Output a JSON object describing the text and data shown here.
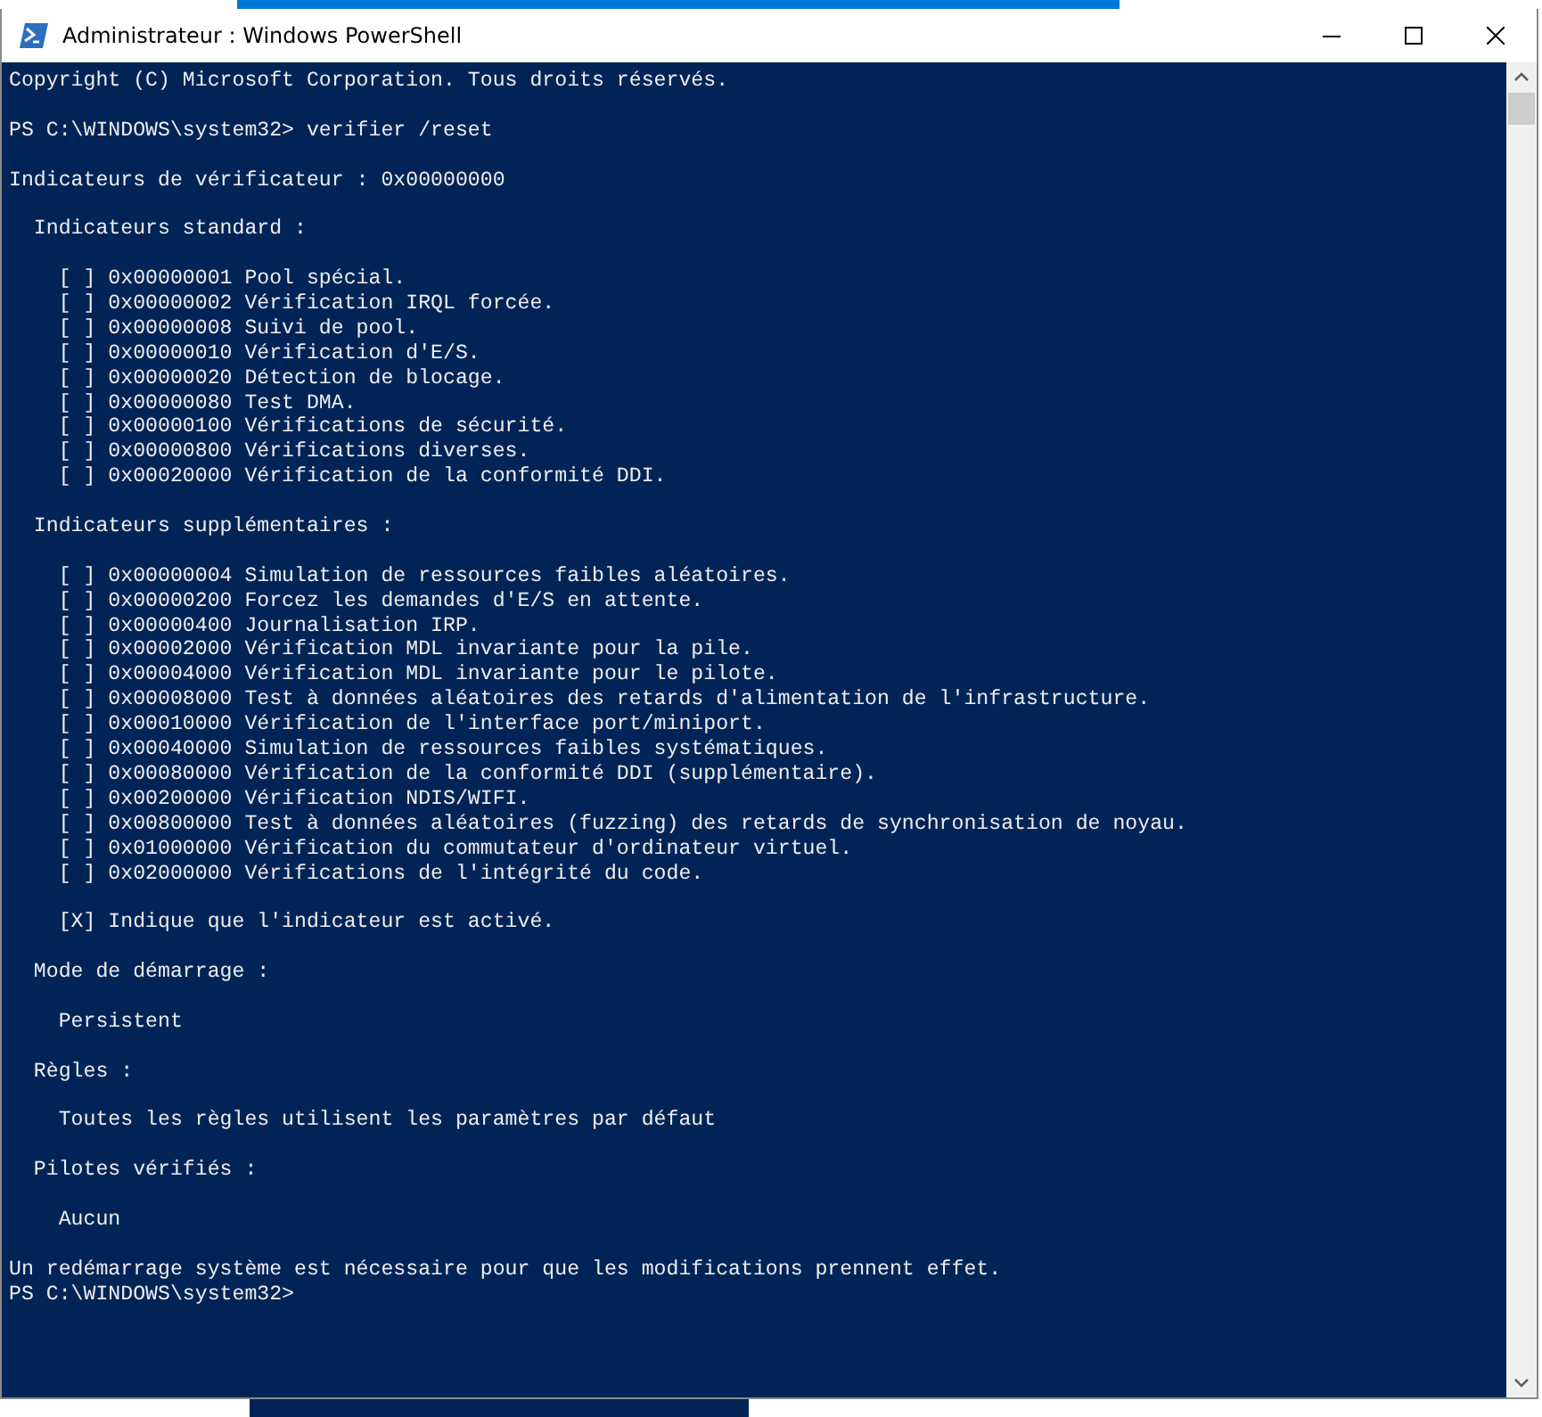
{
  "window": {
    "title": "Administrateur : Windows PowerShell"
  },
  "console": {
    "lines": [
      {
        "kind": "text",
        "text": "Copyright (C) Microsoft Corporation. Tous droits réservés."
      },
      {
        "kind": "blank"
      },
      {
        "kind": "text",
        "text": "PS C:\\WINDOWS\\system32> verifier /reset"
      },
      {
        "kind": "blank"
      },
      {
        "kind": "text",
        "text": "Indicateurs de vérificateur : 0x00000000"
      },
      {
        "kind": "blank"
      },
      {
        "kind": "text",
        "text": "  Indicateurs standard :"
      },
      {
        "kind": "blank"
      },
      {
        "kind": "text",
        "text": "    [ ] 0x00000001 Pool spécial."
      },
      {
        "kind": "text",
        "text": "    [ ] 0x00000002 Vérification IRQL forcée."
      },
      {
        "kind": "text",
        "text": "    [ ] 0x00000008 Suivi de pool."
      },
      {
        "kind": "text",
        "text": "    [ ] 0x00000010 Vérification d'E/S."
      },
      {
        "kind": "text",
        "text": "    [ ] 0x00000020 Détection de blocage."
      },
      {
        "kind": "text",
        "text": "    [ ] 0x00000080 Test DMA."
      },
      {
        "kind": "text",
        "text": "    [ ] 0x00000100 Vérifications de sécurité."
      },
      {
        "kind": "text",
        "text": "    [ ] 0x00000800 Vérifications diverses."
      },
      {
        "kind": "text",
        "text": "    [ ] 0x00020000 Vérification de la conformité DDI."
      },
      {
        "kind": "blank"
      },
      {
        "kind": "text",
        "text": "  Indicateurs supplémentaires :"
      },
      {
        "kind": "blank"
      },
      {
        "kind": "text",
        "text": "    [ ] 0x00000004 Simulation de ressources faibles aléatoires."
      },
      {
        "kind": "text",
        "text": "    [ ] 0x00000200 Forcez les demandes d'E/S en attente."
      },
      {
        "kind": "text",
        "text": "    [ ] 0x00000400 Journalisation IRP."
      },
      {
        "kind": "text",
        "text": "    [ ] 0x00002000 Vérification MDL invariante pour la pile."
      },
      {
        "kind": "text",
        "text": "    [ ] 0x00004000 Vérification MDL invariante pour le pilote."
      },
      {
        "kind": "text",
        "text": "    [ ] 0x00008000 Test à données aléatoires des retards d'alimentation de l'infrastructure."
      },
      {
        "kind": "text",
        "text": "    [ ] 0x00010000 Vérification de l'interface port/miniport."
      },
      {
        "kind": "text",
        "text": "    [ ] 0x00040000 Simulation de ressources faibles systématiques."
      },
      {
        "kind": "text",
        "text": "    [ ] 0x00080000 Vérification de la conformité DDI (supplémentaire)."
      },
      {
        "kind": "text",
        "text": "    [ ] 0x00200000 Vérification NDIS/WIFI."
      },
      {
        "kind": "text",
        "text": "    [ ] 0x00800000 Test à données aléatoires (fuzzing) des retards de synchronisation de noyau."
      },
      {
        "kind": "text",
        "text": "    [ ] 0x01000000 Vérification du commutateur d'ordinateur virtuel."
      },
      {
        "kind": "text",
        "text": "    [ ] 0x02000000 Vérifications de l'intégrité du code."
      },
      {
        "kind": "blank"
      },
      {
        "kind": "text",
        "text": "    [X] Indique que l'indicateur est activé."
      },
      {
        "kind": "blank"
      },
      {
        "kind": "text",
        "text": "  Mode de démarrage :"
      },
      {
        "kind": "blank"
      },
      {
        "kind": "text",
        "text": "    Persistent"
      },
      {
        "kind": "blank"
      },
      {
        "kind": "text",
        "text": "  Règles :"
      },
      {
        "kind": "blank"
      },
      {
        "kind": "text",
        "text": "    Toutes les règles utilisent les paramètres par défaut"
      },
      {
        "kind": "blank"
      },
      {
        "kind": "text",
        "text": "  Pilotes vérifiés :"
      },
      {
        "kind": "blank"
      },
      {
        "kind": "text",
        "text": "    Aucun"
      },
      {
        "kind": "blank"
      },
      {
        "kind": "text",
        "text": "Un redémarrage système est nécessaire pour que les modifications prennent effet."
      },
      {
        "kind": "text",
        "text": "PS C:\\WINDOWS\\system32>"
      }
    ]
  }
}
